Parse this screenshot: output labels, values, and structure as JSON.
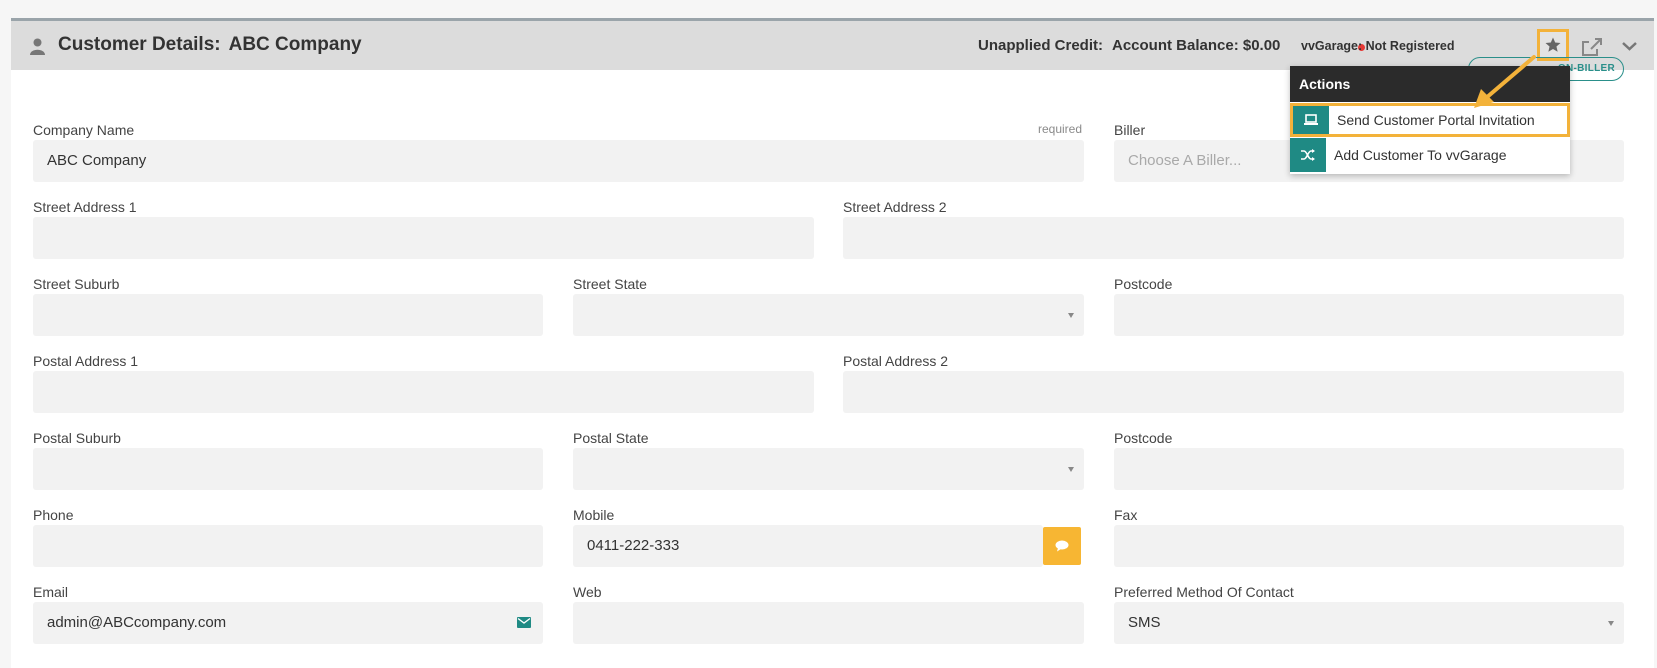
{
  "header": {
    "title_prefix": "Customer Details:",
    "company": "ABC Company",
    "unapplied_credit": "Unapplied Credit:",
    "account_balance": "Account Balance: $0.00",
    "vvgarage_status": "vvGarage: Not Registered",
    "icons": [
      "person-icon",
      "star-icon",
      "external-link-icon",
      "chevron-down-icon"
    ]
  },
  "badge": {
    "nonbiller": "ON-BILLER"
  },
  "actions_menu": {
    "title": "Actions",
    "items": [
      {
        "label": "Send Customer Portal Invitation",
        "icon": "laptop-icon"
      },
      {
        "label": "Add Customer To vvGarage",
        "icon": "shuffle-icon"
      }
    ]
  },
  "form": {
    "company_name": {
      "label": "Company Name",
      "required": "required",
      "value": "ABC Company"
    },
    "biller": {
      "label": "Biller",
      "placeholder": "Choose A Biller..."
    },
    "street_address_1": {
      "label": "Street Address 1",
      "value": ""
    },
    "street_address_2": {
      "label": "Street Address 2",
      "value": ""
    },
    "street_suburb": {
      "label": "Street Suburb",
      "value": ""
    },
    "street_state": {
      "label": "Street State",
      "value": ""
    },
    "street_postcode": {
      "label": "Postcode",
      "value": ""
    },
    "postal_address_1": {
      "label": "Postal Address 1",
      "value": ""
    },
    "postal_address_2": {
      "label": "Postal Address 2",
      "value": ""
    },
    "postal_suburb": {
      "label": "Postal Suburb",
      "value": ""
    },
    "postal_state": {
      "label": "Postal State",
      "value": ""
    },
    "postal_postcode": {
      "label": "Postcode",
      "value": ""
    },
    "phone": {
      "label": "Phone",
      "value": ""
    },
    "mobile": {
      "label": "Mobile",
      "value": "0411-222-333"
    },
    "fax": {
      "label": "Fax",
      "value": ""
    },
    "email": {
      "label": "Email",
      "value": "admin@ABCcompany.com"
    },
    "web": {
      "label": "Web",
      "value": ""
    },
    "preferred_contact": {
      "label": "Preferred Method Of Contact",
      "value": "SMS"
    }
  },
  "colors": {
    "accent_teal": "#1f8a84",
    "highlight_orange": "#f3b23a",
    "sms_button": "#f7b633",
    "status_dot": "#e53935"
  }
}
